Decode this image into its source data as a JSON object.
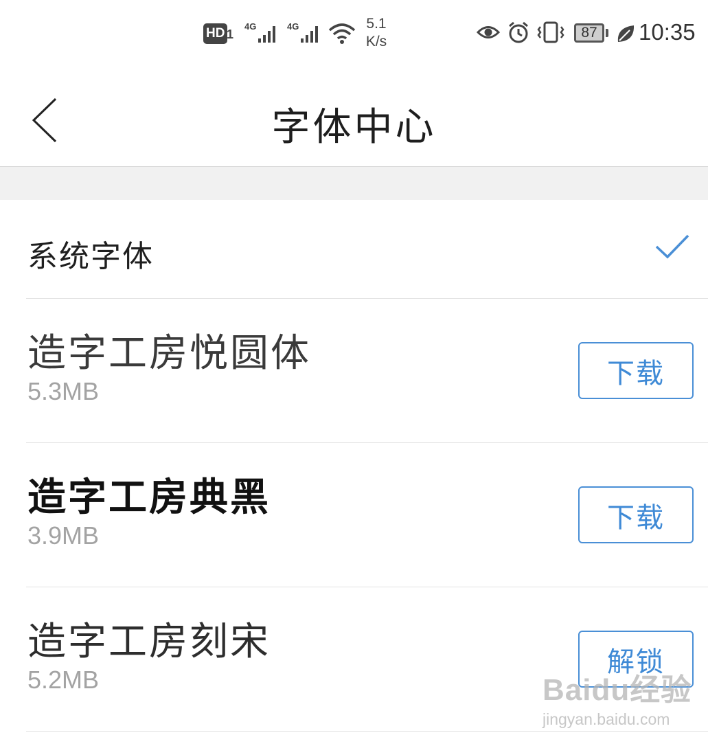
{
  "status_bar": {
    "hd_label": "HD",
    "sim_number": "1",
    "net_type_1": "4G",
    "net_type_2": "4G",
    "net_speed_value": "5.1",
    "net_speed_unit": "K/s",
    "battery_level": "87",
    "time": "10:35",
    "icons": [
      "signal-icon",
      "wifi-icon",
      "eye-icon",
      "alarm-icon",
      "vibrate-icon",
      "battery-icon",
      "leaf-icon"
    ]
  },
  "header": {
    "back_icon": "chevron-left-icon",
    "title": "字体中心"
  },
  "system_font": {
    "label": "系统字体",
    "selected": true,
    "check_icon": "checkmark-icon"
  },
  "fonts": [
    {
      "name": "造字工房悦圆体",
      "size": "5.3MB",
      "action": "下载"
    },
    {
      "name": "造字工房典黑",
      "size": "3.9MB",
      "action": "下载"
    },
    {
      "name": "造字工房刻宋",
      "size": "5.2MB",
      "action": "解锁"
    }
  ],
  "watermark": {
    "logo_text": "Baidu经验",
    "url": "jingyan.baidu.com"
  },
  "colors": {
    "accent": "#3f8ad6",
    "divider": "#e3e3e3",
    "band": "#f1f1f1",
    "secondary_text": "#a3a3a3"
  }
}
